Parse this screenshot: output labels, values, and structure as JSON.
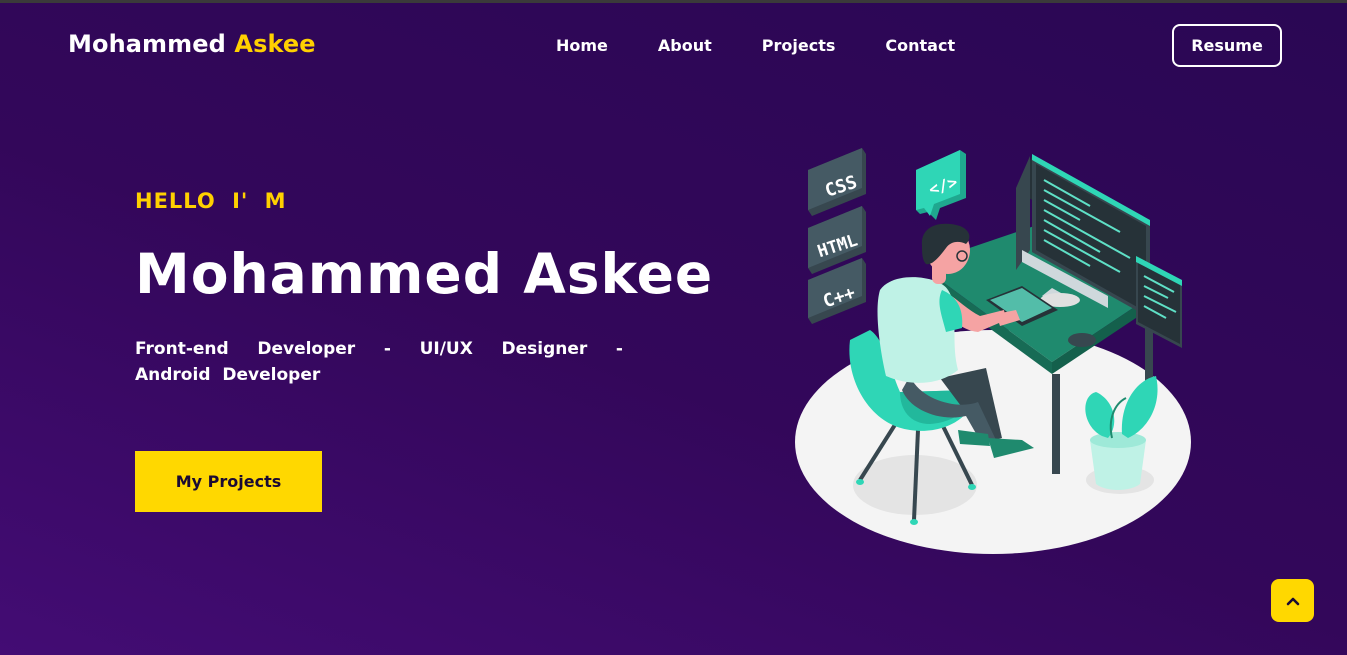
{
  "logo": {
    "first": "Mohammed",
    "last": "Askee"
  },
  "nav": {
    "items": [
      "Home",
      "About",
      "Projects",
      "Contact"
    ],
    "resume_label": "Resume"
  },
  "hero": {
    "greeting": "HELLO I' M",
    "name": "Mohammed Askee",
    "roles": "Front-end Developer - UI/UX Designer - Android Developer",
    "cta_label": "My Projects"
  },
  "illustration": {
    "badges": [
      "CSS",
      "HTML",
      "C++"
    ],
    "code_bubble": "</>"
  },
  "icons": {
    "scroll_top": "chevron-up-icon"
  },
  "colors": {
    "accent": "#ffd000",
    "teal": "#2fd6b6",
    "background": "#33075a"
  }
}
